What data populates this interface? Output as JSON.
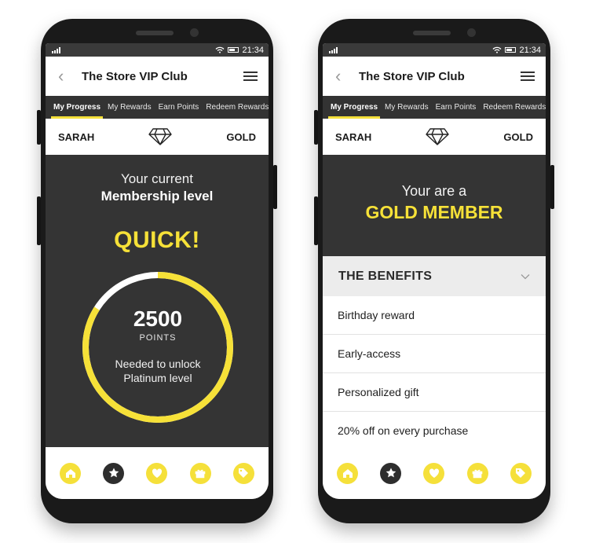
{
  "status_bar": {
    "time": "21:34"
  },
  "app": {
    "title": "The Store VIP Club"
  },
  "tabs": [
    {
      "label": "My Progress",
      "active": true
    },
    {
      "label": "My Rewards",
      "active": false
    },
    {
      "label": "Earn Points",
      "active": false
    },
    {
      "label": "Redeem Rewards",
      "active": false
    }
  ],
  "member": {
    "name": "SARAH",
    "tier": "GOLD"
  },
  "progress_screen": {
    "current_label": "Your current",
    "level_label": "Membership level",
    "level_value": "QUICK!",
    "points_value": "2500",
    "points_unit": "POINTS",
    "unlock_line1": "Needed to unlock",
    "unlock_line2": "Platinum level",
    "progress_fraction": 0.84
  },
  "benefits_screen": {
    "pre_title": "Your are a",
    "title": "GOLD MEMBER",
    "benefits_header": "THE BENEFITS",
    "benefits": [
      "Birthday reward",
      "Early-access",
      "Personalized gift",
      "20% off on every purchase"
    ]
  },
  "bottom_nav": [
    {
      "icon": "home-icon",
      "active": false
    },
    {
      "icon": "star-icon",
      "active": true
    },
    {
      "icon": "heart-icon",
      "active": false
    },
    {
      "icon": "gift-icon",
      "active": false
    },
    {
      "icon": "tag-icon",
      "active": false
    }
  ],
  "colors": {
    "accent": "#f6e138",
    "dark": "#343434"
  }
}
